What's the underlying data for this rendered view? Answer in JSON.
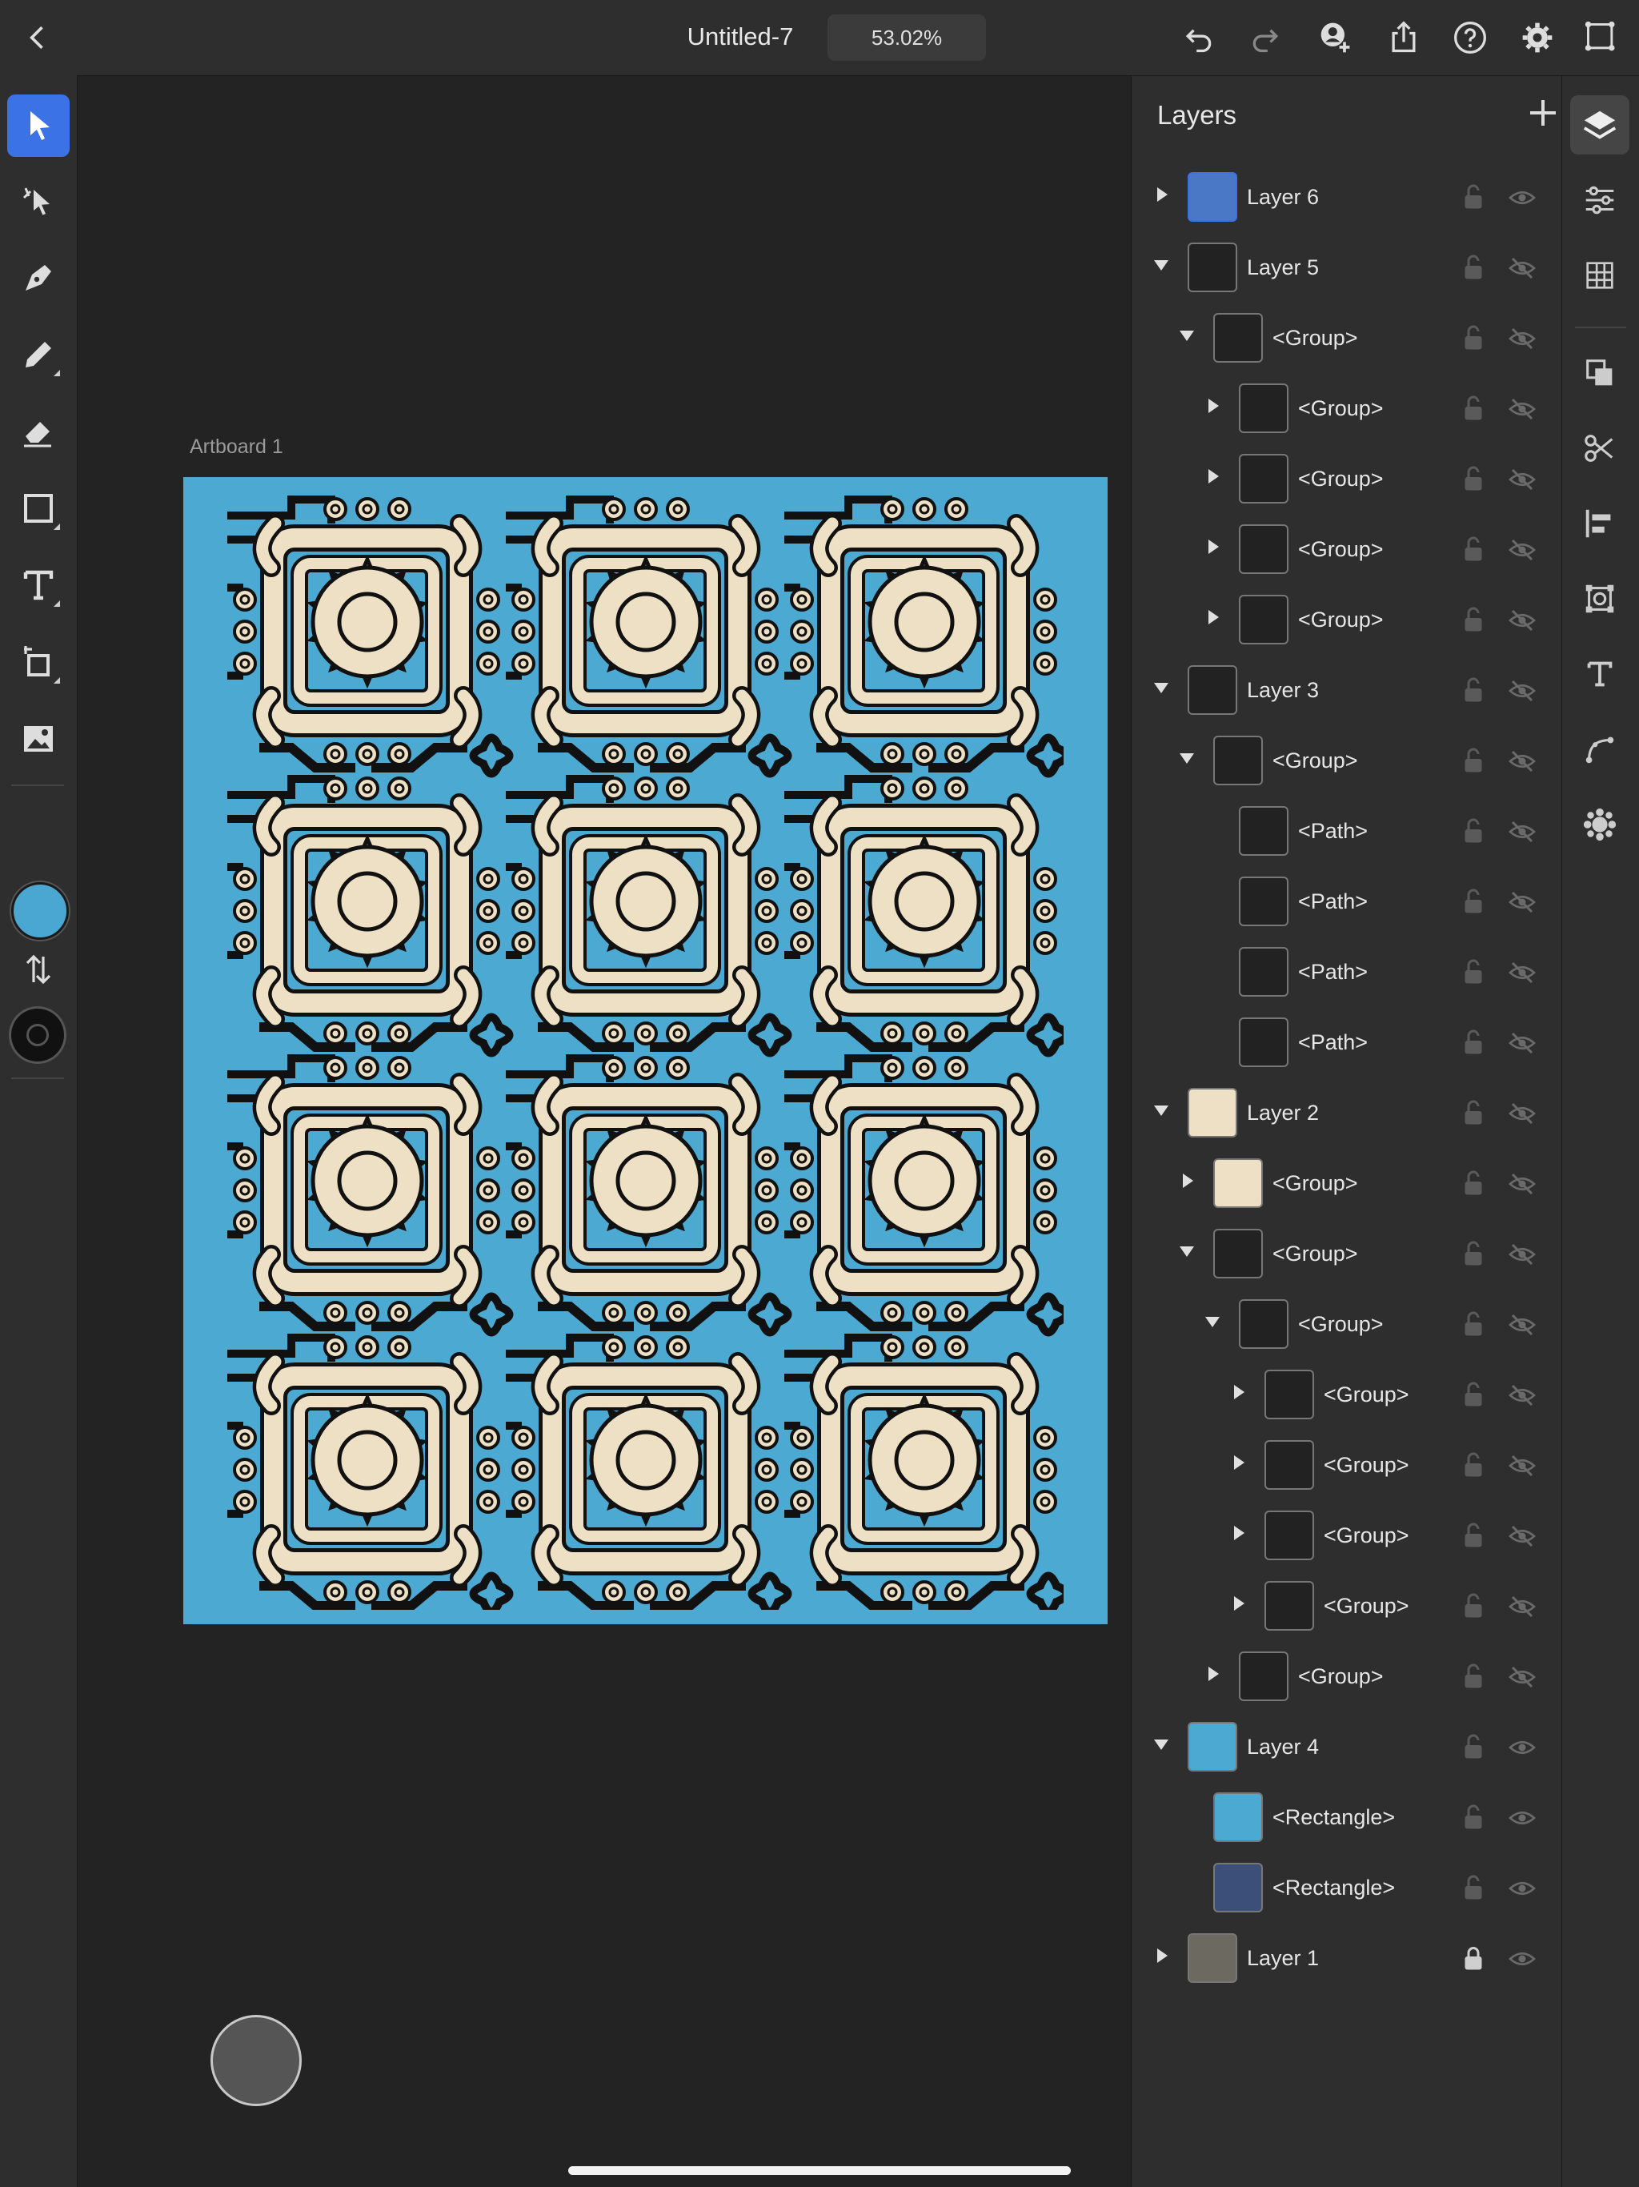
{
  "app": {
    "doc_title": "Untitled-7",
    "zoom": "53.02%",
    "artboard_label": "Artboard 1"
  },
  "topbar": {
    "left_icons": [
      "back-chevron-icon"
    ],
    "right_icons": [
      "undo-icon",
      "redo-icon",
      "invite-user-icon",
      "share-icon",
      "help-icon",
      "settings-icon",
      "transform-icon"
    ]
  },
  "tools": [
    "select-icon",
    "direct-select-icon",
    "pen-icon",
    "pencil-icon",
    "eraser-icon",
    "rectangle-icon",
    "type-icon",
    "shape-builder-icon",
    "image-icon",
    "fill-swatch",
    "swap-icon",
    "stroke-swatch"
  ],
  "colors": {
    "fill": "#4aa7d1",
    "stroke": "#111111",
    "artboard_bg": "#4ba9d2",
    "pattern_cream": "#ede0c4",
    "accent": "#3b73e6"
  },
  "layers_panel": {
    "title": "Layers",
    "add_label": "+",
    "rows": [
      {
        "name": "Layer 6",
        "depth": 0,
        "twirl": "closed",
        "visible": true,
        "locked": false
      },
      {
        "name": "Layer 5",
        "depth": 0,
        "twirl": "open",
        "visible": false,
        "locked": false
      },
      {
        "name": "<Group>",
        "depth": 1,
        "twirl": "open",
        "visible": false,
        "locked": false
      },
      {
        "name": "<Group>",
        "depth": 2,
        "twirl": "closed",
        "visible": false,
        "locked": false
      },
      {
        "name": "<Group>",
        "depth": 2,
        "twirl": "closed",
        "visible": false,
        "locked": false
      },
      {
        "name": "<Group>",
        "depth": 2,
        "twirl": "closed",
        "visible": false,
        "locked": false
      },
      {
        "name": "<Group>",
        "depth": 2,
        "twirl": "closed",
        "visible": false,
        "locked": false
      },
      {
        "name": "Layer 3",
        "depth": 0,
        "twirl": "open",
        "visible": false,
        "locked": false
      },
      {
        "name": "<Group>",
        "depth": 1,
        "twirl": "open",
        "visible": false,
        "locked": false
      },
      {
        "name": "<Path>",
        "depth": 2,
        "twirl": "none",
        "visible": false,
        "locked": false
      },
      {
        "name": "<Path>",
        "depth": 2,
        "twirl": "none",
        "visible": false,
        "locked": false
      },
      {
        "name": "<Path>",
        "depth": 2,
        "twirl": "none",
        "visible": false,
        "locked": false
      },
      {
        "name": "<Path>",
        "depth": 2,
        "twirl": "none",
        "visible": false,
        "locked": false
      },
      {
        "name": "Layer 2",
        "depth": 0,
        "twirl": "open",
        "visible": false,
        "locked": false
      },
      {
        "name": "<Group>",
        "depth": 1,
        "twirl": "closed",
        "visible": false,
        "locked": false
      },
      {
        "name": "<Group>",
        "depth": 1,
        "twirl": "open",
        "visible": false,
        "locked": false
      },
      {
        "name": "<Group>",
        "depth": 2,
        "twirl": "open",
        "visible": false,
        "locked": false
      },
      {
        "name": "<Group>",
        "depth": 3,
        "twirl": "closed",
        "visible": false,
        "locked": false
      },
      {
        "name": "<Group>",
        "depth": 3,
        "twirl": "closed",
        "visible": false,
        "locked": false
      },
      {
        "name": "<Group>",
        "depth": 3,
        "twirl": "closed",
        "visible": false,
        "locked": false
      },
      {
        "name": "<Group>",
        "depth": 3,
        "twirl": "closed",
        "visible": false,
        "locked": false
      },
      {
        "name": "<Group>",
        "depth": 2,
        "twirl": "closed",
        "visible": false,
        "locked": false
      },
      {
        "name": "Layer 4",
        "depth": 0,
        "twirl": "open",
        "visible": true,
        "locked": false
      },
      {
        "name": "<Rectangle>",
        "depth": 1,
        "twirl": "none",
        "visible": true,
        "locked": false
      },
      {
        "name": "<Rectangle>",
        "depth": 1,
        "twirl": "none",
        "visible": true,
        "locked": false
      },
      {
        "name": "Layer 1",
        "depth": 0,
        "twirl": "closed",
        "visible": true,
        "locked": true
      }
    ]
  },
  "right_rail": [
    "layers-icon",
    "properties-icon",
    "grid-icon",
    "arrange-icon",
    "cut-icon",
    "align-icon",
    "repeat-grid-icon",
    "text-style-icon",
    "path-icon",
    "pattern-icon"
  ]
}
